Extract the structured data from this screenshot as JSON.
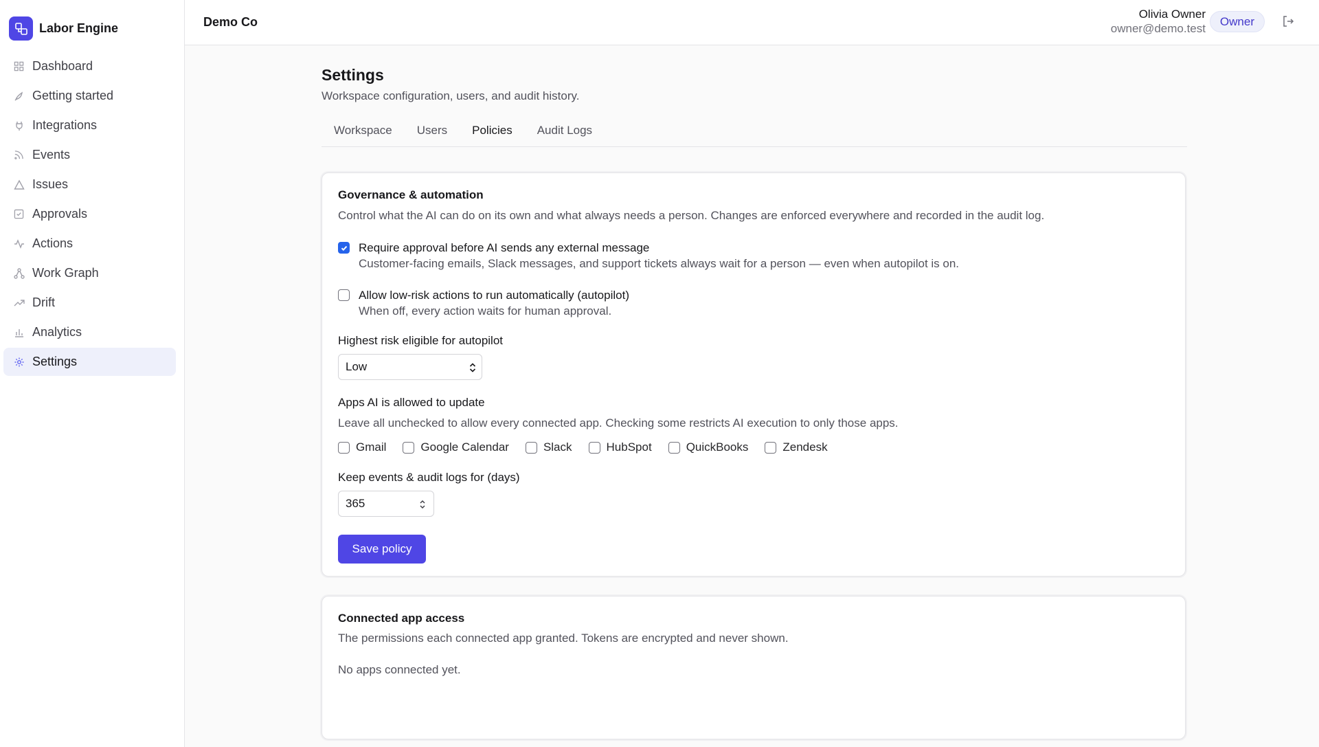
{
  "brand": {
    "name": "Labor Engine",
    "icon": "logo-icon"
  },
  "sidebar": {
    "items": [
      {
        "label": "Dashboard",
        "icon": "grid-icon"
      },
      {
        "label": "Getting started",
        "icon": "rocket-icon"
      },
      {
        "label": "Integrations",
        "icon": "plug-icon"
      },
      {
        "label": "Events",
        "icon": "rss-icon"
      },
      {
        "label": "Issues",
        "icon": "alert-triangle-icon"
      },
      {
        "label": "Approvals",
        "icon": "check-square-icon"
      },
      {
        "label": "Actions",
        "icon": "activity-icon"
      },
      {
        "label": "Work Graph",
        "icon": "network-icon"
      },
      {
        "label": "Drift",
        "icon": "trending-up-icon"
      },
      {
        "label": "Analytics",
        "icon": "bar-chart-icon"
      },
      {
        "label": "Settings",
        "icon": "gear-icon",
        "active": true
      }
    ]
  },
  "header": {
    "org": "Demo Co",
    "user_name": "Olivia Owner",
    "user_email": "owner@demo.test",
    "role": "Owner",
    "logout_icon": "logout-icon"
  },
  "page": {
    "title": "Settings",
    "subtitle": "Workspace configuration, users, and audit history.",
    "tabs": [
      {
        "label": "Workspace"
      },
      {
        "label": "Users"
      },
      {
        "label": "Policies",
        "active": true
      },
      {
        "label": "Audit Logs"
      }
    ]
  },
  "governance": {
    "title": "Governance & automation",
    "description": "Control what the AI can do on its own and what always needs a person. Changes are enforced everywhere and recorded in the audit log.",
    "require_approval": {
      "label": "Require approval before AI sends any external message",
      "help": "Customer-facing emails, Slack messages, and support tickets always wait for a person — even when autopilot is on.",
      "checked": true
    },
    "autopilot": {
      "label": "Allow low-risk actions to run automatically (autopilot)",
      "help": "When off, every action waits for human approval.",
      "checked": false
    },
    "risk_label": "Highest risk eligible for autopilot",
    "risk_value": "Low",
    "apps_label": "Apps AI is allowed to update",
    "apps_help": "Leave all unchecked to allow every connected app. Checking some restricts AI execution to only those apps.",
    "apps": [
      {
        "label": "Gmail",
        "checked": false
      },
      {
        "label": "Google Calendar",
        "checked": false
      },
      {
        "label": "Slack",
        "checked": false
      },
      {
        "label": "HubSpot",
        "checked": false
      },
      {
        "label": "QuickBooks",
        "checked": false
      },
      {
        "label": "Zendesk",
        "checked": false
      }
    ],
    "retention_label": "Keep events & audit logs for (days)",
    "retention_value": "365",
    "save_label": "Save policy"
  },
  "connected": {
    "title": "Connected app access",
    "description": "The permissions each connected app granted. Tokens are encrypted and never shown.",
    "empty": "No apps connected yet."
  },
  "colors": {
    "accent": "#4f46e5",
    "checkbox": "#2563eb",
    "active_nav_bg": "#eef0fb"
  }
}
